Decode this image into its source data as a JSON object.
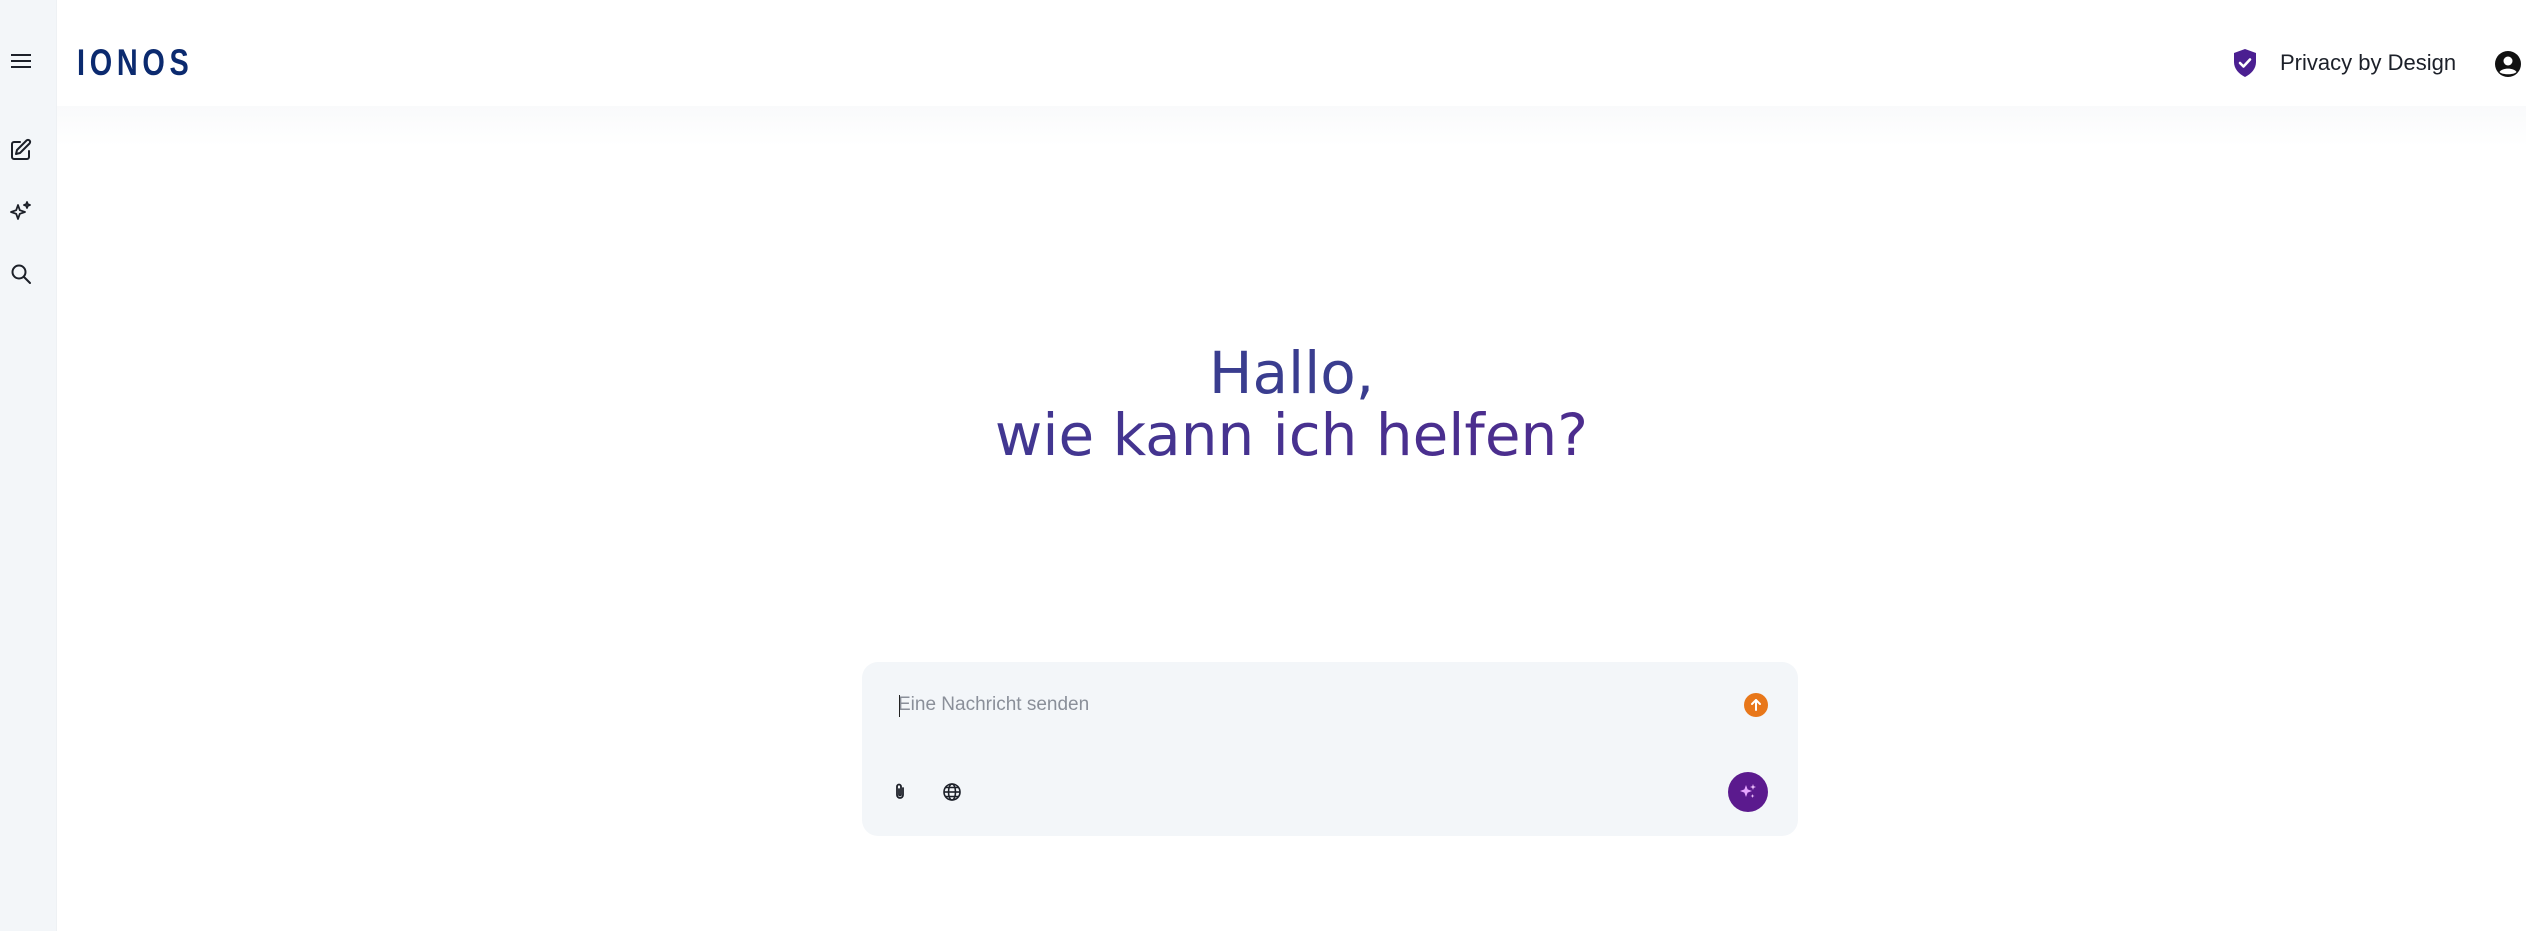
{
  "app": {
    "logo_text": "IONOS",
    "brand_color": "#0b2a6f"
  },
  "sidebar": {
    "items": [
      {
        "name": "menu",
        "icon": "hamburger-icon"
      },
      {
        "name": "new-chat",
        "icon": "edit-icon"
      },
      {
        "name": "assistants",
        "icon": "sparkles-icon"
      },
      {
        "name": "search",
        "icon": "search-icon"
      }
    ]
  },
  "header": {
    "privacy_label": "Privacy by Design",
    "privacy_icon": "shield-check-icon",
    "account_icon": "account-circle-icon"
  },
  "greeting": {
    "line1": "Hallo,",
    "line2": "wie kann ich helfen?"
  },
  "composer": {
    "placeholder": "Eine Nachricht senden",
    "value": "",
    "send_icon": "arrow-up-icon",
    "attach_icon": "paperclip-icon",
    "web_icon": "globe-icon",
    "magic_icon": "sparkle-magic-icon"
  },
  "colors": {
    "accent_orange": "#e8771a",
    "accent_purple": "#5b1a8e",
    "greeting_blue": "#2d4a96",
    "greeting_purple": "#5a1f86",
    "privacy_shield": "#4b1f91"
  }
}
